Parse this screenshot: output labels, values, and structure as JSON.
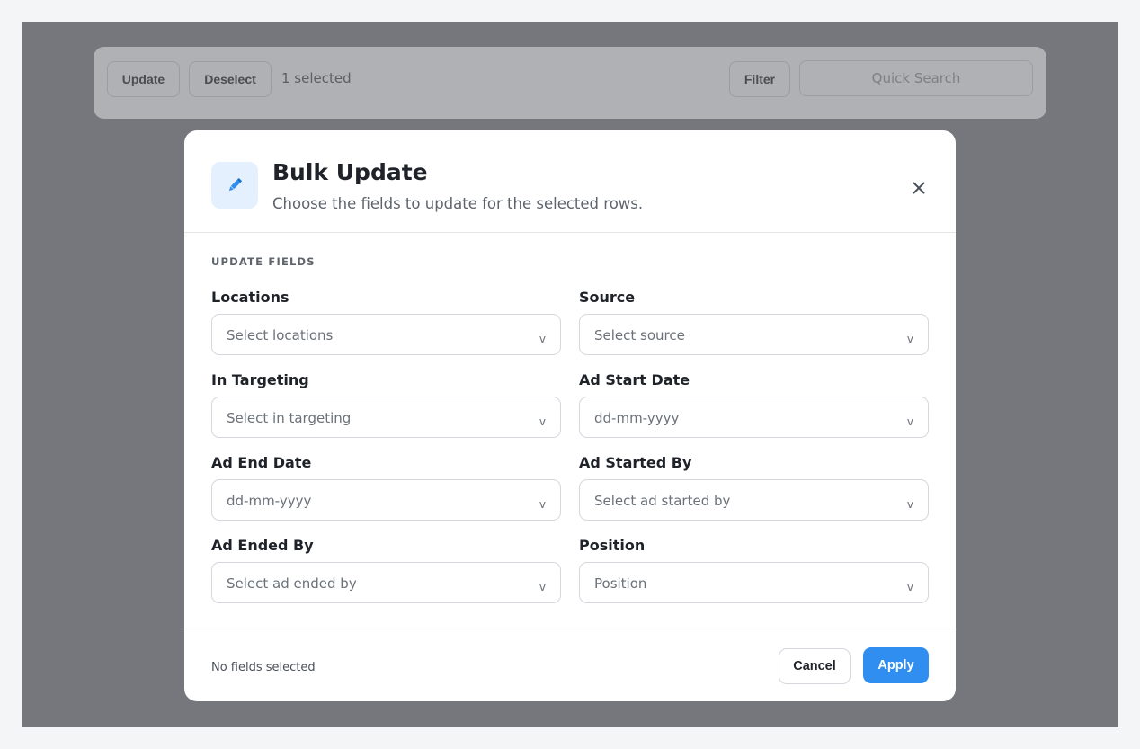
{
  "toolbar": {
    "update_label": "Update",
    "deselect_label": "Deselect",
    "selected_text": "1 selected",
    "filter_label": "Filter",
    "search_placeholder": "Quick Search"
  },
  "modal": {
    "title": "Bulk Update",
    "subtitle": "Choose the fields to update for the selected rows.",
    "header_icon": "pencil-icon",
    "close_icon": "close-icon",
    "section_label": "UPDATE FIELDS",
    "fields": [
      {
        "label": "Locations",
        "placeholder": "Select locations"
      },
      {
        "label": "Source",
        "placeholder": "Select source"
      },
      {
        "label": "In Targeting",
        "placeholder": "Select in targeting"
      },
      {
        "label": "Ad Start Date",
        "placeholder": "dd-mm-yyyy"
      },
      {
        "label": "Ad End Date",
        "placeholder": "dd-mm-yyyy"
      },
      {
        "label": "Ad Started By",
        "placeholder": "Select ad started by"
      },
      {
        "label": "Ad Ended By",
        "placeholder": "Select ad ended by"
      },
      {
        "label": "Position",
        "placeholder": "Position"
      }
    ],
    "chevron_glyph": "v",
    "footer": {
      "status_text": "No fields selected",
      "cancel_label": "Cancel",
      "apply_label": "Apply"
    }
  },
  "colors": {
    "accent": "#2f8ef0",
    "overlay": "#75777c",
    "icon_tile": "#e4f0fd"
  }
}
